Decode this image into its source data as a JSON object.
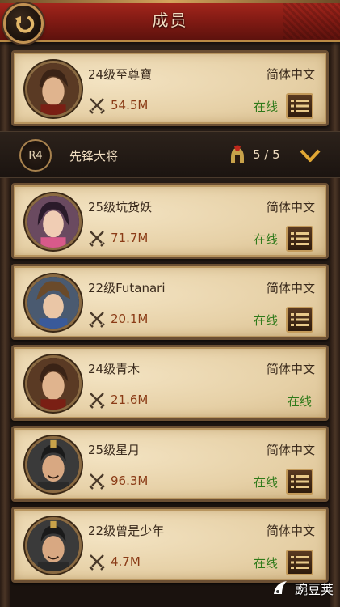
{
  "header": {
    "title": "成员"
  },
  "rank_group": {
    "badge": "R4",
    "title": "先锋大将",
    "count": "5 / 5"
  },
  "members": [
    {
      "name": "24级至尊寶",
      "language": "简体中文",
      "power": "54.5M",
      "status": "在线",
      "has_menu": true
    },
    {
      "name": "25级坑货妖",
      "language": "简体中文",
      "power": "71.7M",
      "status": "在线",
      "has_menu": true
    },
    {
      "name": "22级Futanari",
      "language": "简体中文",
      "power": "20.1M",
      "status": "在线",
      "has_menu": true
    },
    {
      "name": "24级青木",
      "language": "简体中文",
      "power": "21.6M",
      "status": "在线",
      "has_menu": false
    },
    {
      "name": "25级星月",
      "language": "简体中文",
      "power": "96.3M",
      "status": "在线",
      "has_menu": true
    },
    {
      "name": "22级曾是少年",
      "language": "简体中文",
      "power": "4.7M",
      "status": "在线",
      "has_menu": true
    }
  ],
  "watermark": {
    "text": "豌豆荚"
  },
  "colors": {
    "header_red": "#8f1f16",
    "status_green": "#2f7a1a",
    "power_text": "#8a3b16",
    "gold_border": "#c39a5a"
  }
}
